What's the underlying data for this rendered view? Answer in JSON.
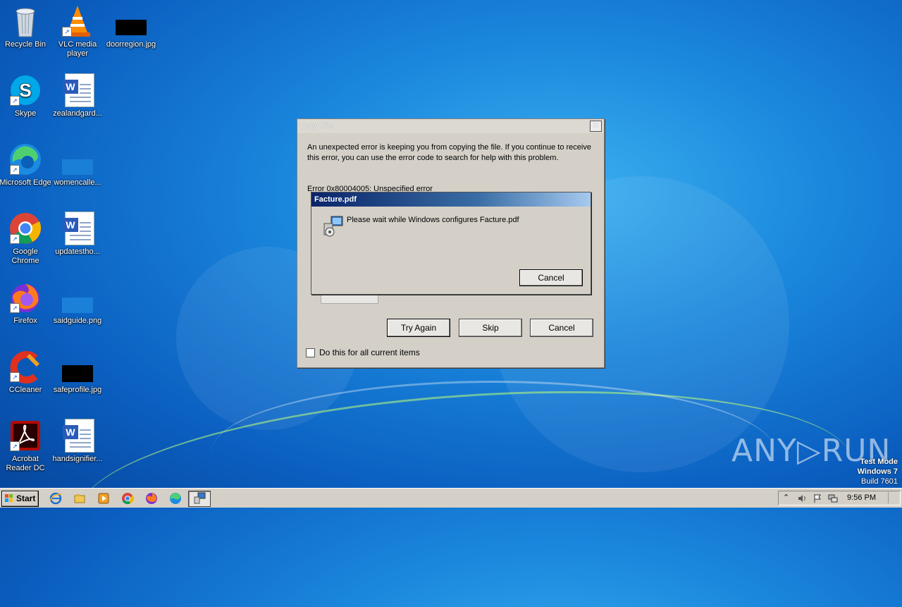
{
  "desktop": {
    "icons": [
      {
        "label": "Recycle Bin"
      },
      {
        "label": "VLC media player"
      },
      {
        "label": "doorregion.jpg"
      },
      {
        "label": "Skype"
      },
      {
        "label": "zealandgard..."
      },
      {
        "label": "Microsoft Edge"
      },
      {
        "label": "womencalle..."
      },
      {
        "label": "Google Chrome"
      },
      {
        "label": "updatestho..."
      },
      {
        "label": "Firefox"
      },
      {
        "label": "saidguide.png"
      },
      {
        "label": "CCleaner"
      },
      {
        "label": "safeprofile.jpg"
      },
      {
        "label": "Acrobat Reader DC"
      },
      {
        "label": "handsignifier..."
      }
    ]
  },
  "copy_dialog": {
    "title": "Copy File",
    "close_glyph": "✕",
    "message": "An unexpected error is keeping you from copying the file. If you continue to receive this error, you can use the error code to search for help with this problem.",
    "error": "Error 0x80004005: Unspecified error",
    "try_again": "Try Again",
    "skip": "Skip",
    "cancel": "Cancel",
    "checkbox_label": "Do this for all current items"
  },
  "facture_dialog": {
    "title": "Facture.pdf",
    "message": "Please wait while Windows configures Facture.pdf",
    "cancel": "Cancel"
  },
  "taskbar": {
    "start": "Start",
    "clock": "9:56 PM"
  },
  "watermark": {
    "line1": "Test Mode",
    "line2": "Windows 7",
    "line3": "Build 7601",
    "brand": "ANY▷RUN"
  }
}
